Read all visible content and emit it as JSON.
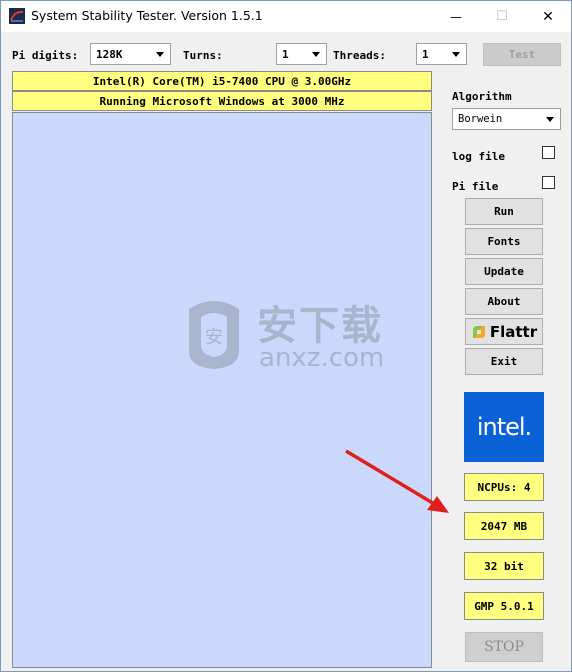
{
  "window": {
    "title": "System Stability Tester. Version 1.5.1",
    "min_glyph": "—",
    "max_glyph": "☐",
    "close_glyph": "✕"
  },
  "controls": {
    "pi_digits_label": "Pi digits:",
    "pi_digits_value": "128K",
    "turns_label": "Turns:",
    "turns_value": "1",
    "threads_label": "Threads:",
    "threads_value": "1",
    "test_label": "Test"
  },
  "info": {
    "cpu": "Intel(R) Core(TM) i5-7400 CPU @ 3.00GHz",
    "os": "Running Microsoft Windows at 3000 MHz"
  },
  "sidebar": {
    "algorithm_label": "Algorithm",
    "algorithm_value": "Borwein",
    "log_file_label": "log file",
    "log_file_checked": false,
    "pi_file_label": "Pi file",
    "pi_file_checked": false,
    "buttons": {
      "run": "Run",
      "fonts": "Fonts",
      "update": "Update",
      "about": "About",
      "flattr": "Flattr",
      "exit": "Exit"
    },
    "intel_logo": "intel.",
    "ncpus": "NCPUs: 4",
    "memory": "2047 MB",
    "bits": "32 bit",
    "gmp": "GMP 5.0.1",
    "stop": "STOP"
  },
  "watermark": {
    "main": "安下载",
    "sub": "anxz.com"
  },
  "colors": {
    "output_bg": "#cad9fb",
    "info_bg": "#ffff80",
    "intel_blue": "#0a62d6",
    "arrow_red": "#e0201c"
  }
}
